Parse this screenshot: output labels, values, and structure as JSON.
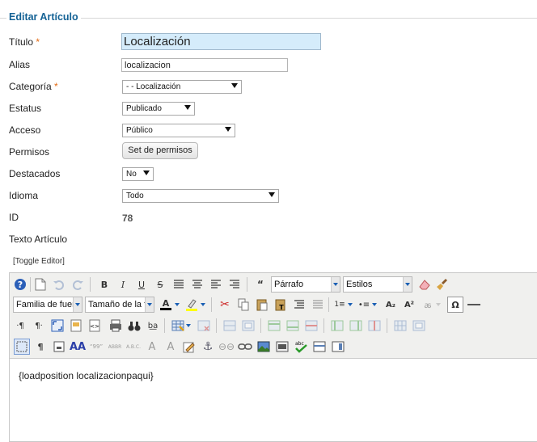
{
  "legend": "Editar Artículo",
  "fields": {
    "titulo": {
      "label": "Título",
      "required": "*",
      "value": "Localización"
    },
    "alias": {
      "label": "Alias",
      "value": "localizacion"
    },
    "categoria": {
      "label": "Categoría",
      "required": "*",
      "value": "- - Localización"
    },
    "estatus": {
      "label": "Estatus",
      "value": "Publicado"
    },
    "acceso": {
      "label": "Acceso",
      "value": "Público"
    },
    "permisos": {
      "label": "Permisos",
      "button": "Set de permisos"
    },
    "destacados": {
      "label": "Destacados",
      "value": "No"
    },
    "idioma": {
      "label": "Idioma",
      "value": "Todo"
    },
    "id": {
      "label": "ID",
      "value": "78"
    },
    "texto": {
      "label": "Texto Artículo"
    }
  },
  "editor": {
    "toggle": "[Toggle Editor]",
    "paragraph_format": "Párrafo",
    "styles": "Estilos",
    "font_family": "Familia de fuer",
    "font_size": "Tamaño de la f",
    "content": "{loadposition localizacionpaqui}"
  }
}
